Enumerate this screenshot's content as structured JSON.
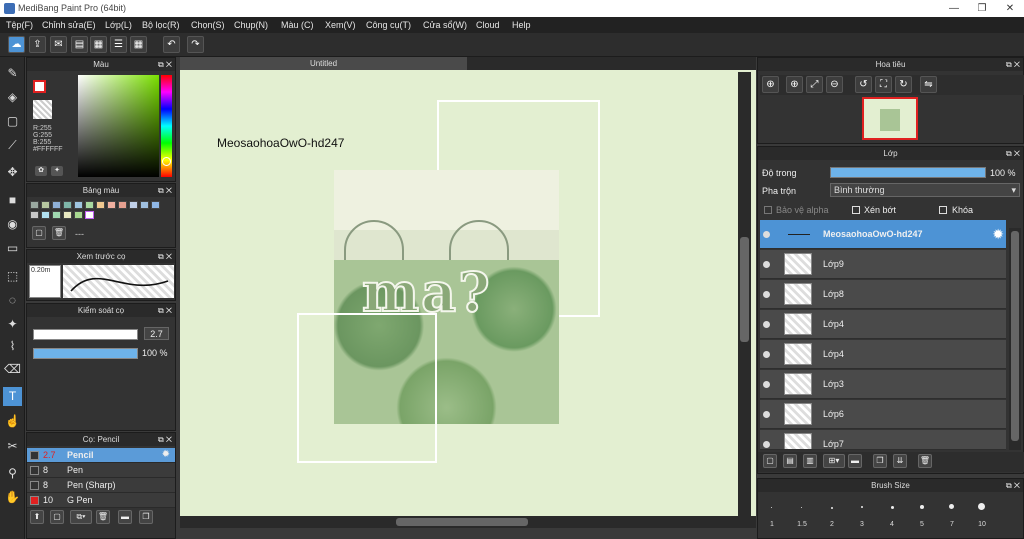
{
  "app": {
    "title": "MediBang Paint Pro (64bit)"
  },
  "window_controls": {
    "minimize": "—",
    "maximize": "❐",
    "close": "✕"
  },
  "menu": [
    "Tệp(F)",
    "Chỉnh sửa(E)",
    "Lớp(L)",
    "Bộ lọc(R)",
    "Chọn(S)",
    "Chụp(N)",
    "Màu (C)",
    "Xem(V)",
    "Công cụ(T)",
    "Cửa sổ(W)",
    "Cloud",
    "Help"
  ],
  "canvas": {
    "tab": "Untitled",
    "text_layer_text": "MeosaohoaOwO-hd247",
    "artwork_text": "ma?"
  },
  "color_panel": {
    "title": "Màu",
    "r": "R:255",
    "g": "G:255",
    "b": "B:255",
    "hex": "#FFFFFF",
    "hue_level": 0.88
  },
  "palette_panel": {
    "title": "Bảng màu",
    "label": "---"
  },
  "brush_preview": {
    "title": "Xem trước cọ",
    "size": "0.20m"
  },
  "brush_control": {
    "title": "Kiểm soát cọ",
    "size_value": "2.7",
    "opacity_value": "100 %",
    "size_fill": 1.0,
    "opacity_fill": 1.0
  },
  "brush_panel": {
    "title": "Cọ: Pencil",
    "items": [
      {
        "size": "2.7",
        "name": "Pencil",
        "color": "#333333"
      },
      {
        "size": "8",
        "name": "Pen",
        "color": "#333333"
      },
      {
        "size": "8",
        "name": "Pen (Sharp)",
        "color": "#333333"
      },
      {
        "size": "10",
        "name": "G Pen",
        "color": "#e02020"
      }
    ]
  },
  "navigator": {
    "title": "Hoa tiêu"
  },
  "layer_panel": {
    "title": "Lớp",
    "opacity_label": "Độ trong",
    "opacity_value": "100 %",
    "opacity_fill": 1.0,
    "blend_label": "Pha trộn",
    "blend_value": "Bình thường",
    "protect_alpha": "Bảo vệ alpha",
    "clipping": "Xén bớt",
    "lock": "Khóa",
    "layers": [
      "MeosaohoaOwO-hd247",
      "Lớp9",
      "Lớp8",
      "Lớp4",
      "Lớp4",
      "Lớp3",
      "Lớp6",
      "Lớp7"
    ]
  },
  "brush_size_panel": {
    "title": "Brush Size",
    "sizes": [
      "1",
      "1.5",
      "2",
      "3",
      "4",
      "5",
      "7",
      "10"
    ]
  }
}
